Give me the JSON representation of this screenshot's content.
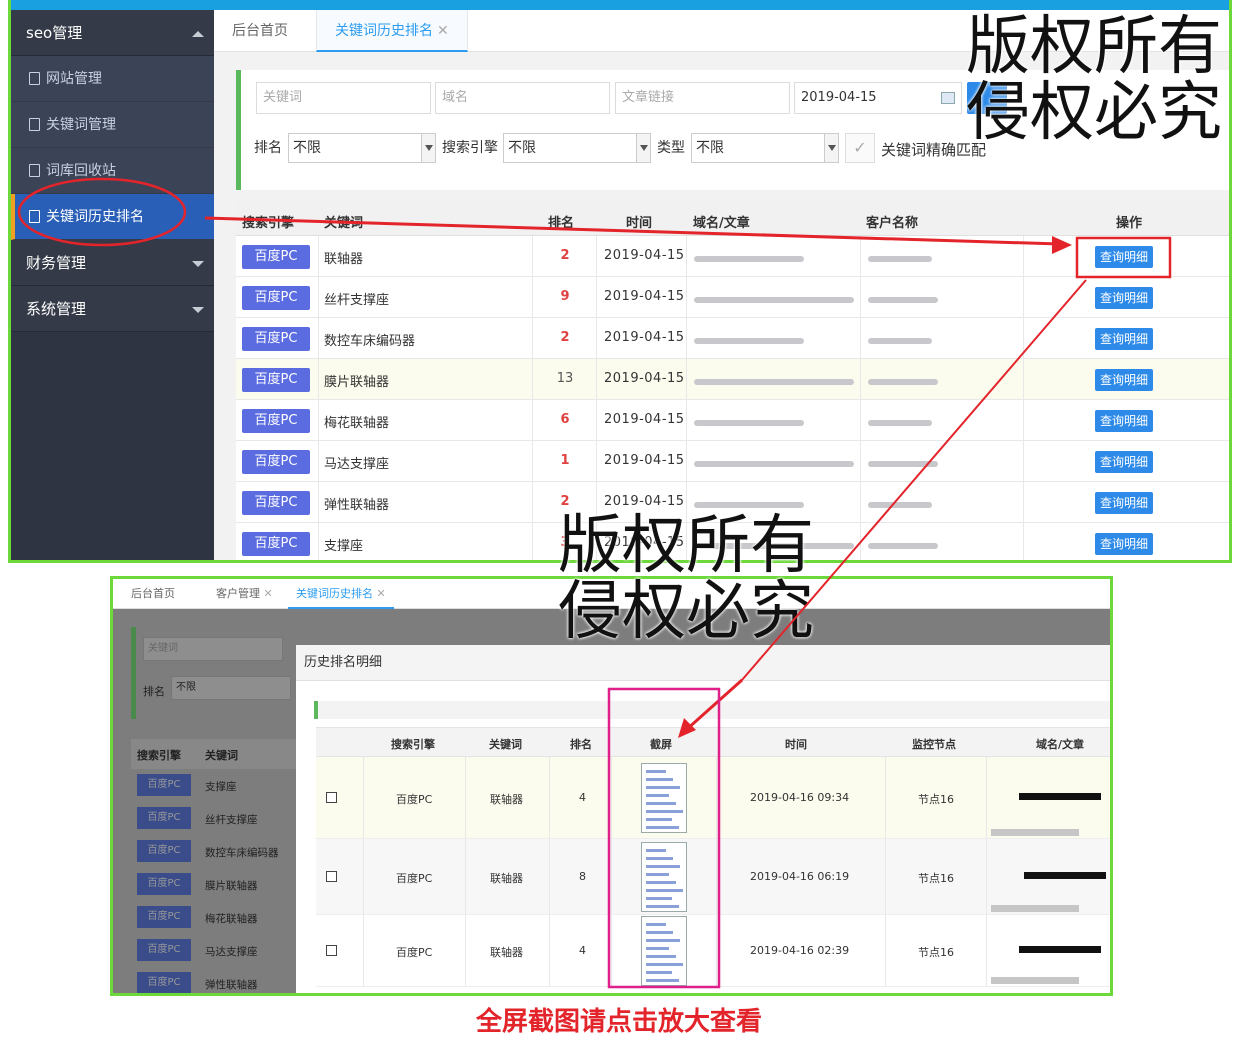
{
  "sidebar": {
    "group_seo": "seo管理",
    "items": [
      "网站管理",
      "关键词管理",
      "词库回收站",
      "关键词历史排名"
    ],
    "group_finance": "财务管理",
    "group_system": "系统管理"
  },
  "tabs": {
    "home": "后台首页",
    "active": "关键词历史排名",
    "close": "✕"
  },
  "filter": {
    "keyword_placeholder": "关键词",
    "domain_placeholder": "域名",
    "article_placeholder": "文章链接",
    "date_value": "2019-04-15",
    "rank_label": "排名",
    "rank_value": "不限",
    "engine_label": "搜索引擎",
    "engine_value": "不限",
    "type_label": "类型",
    "type_value": "不限",
    "exact_label": "关键词精确匹配",
    "check_mark": "✓"
  },
  "table": {
    "headers": [
      "搜索引擎",
      "关键词",
      "排名",
      "时间",
      "域名/文章",
      "客户名称",
      "操作"
    ],
    "button_label": "查询明细",
    "rows": [
      {
        "engine": "百度PC",
        "keyword": "联轴器",
        "rank": "2",
        "date": "2019-04-15"
      },
      {
        "engine": "百度PC",
        "keyword": "丝杆支撑座",
        "rank": "9",
        "date": "2019-04-15"
      },
      {
        "engine": "百度PC",
        "keyword": "数控车床编码器",
        "rank": "2",
        "date": "2019-04-15"
      },
      {
        "engine": "百度PC",
        "keyword": "膜片联轴器",
        "rank": "13",
        "date": "2019-04-15"
      },
      {
        "engine": "百度PC",
        "keyword": "梅花联轴器",
        "rank": "6",
        "date": "2019-04-15"
      },
      {
        "engine": "百度PC",
        "keyword": "马达支撑座",
        "rank": "1",
        "date": "2019-04-15"
      },
      {
        "engine": "百度PC",
        "keyword": "弹性联轴器",
        "rank": "2",
        "date": "2019-04-15"
      },
      {
        "engine": "百度PC",
        "keyword": "支撑座",
        "rank": "3",
        "date": "2019-04-15"
      }
    ]
  },
  "bottom": {
    "tabs": [
      "后台首页",
      "客户管理",
      "关键词历史排名"
    ],
    "shade_keyword_placeholder": "关键词",
    "shade_rank_label": "排名",
    "shade_rank_value": "不限",
    "shade_headers": [
      "搜索引擎",
      "关键词"
    ],
    "shade_rows": [
      {
        "engine": "百度PC",
        "keyword": "支撑座"
      },
      {
        "engine": "百度PC",
        "keyword": "丝杆支撑座"
      },
      {
        "engine": "百度PC",
        "keyword": "数控车床编码器"
      },
      {
        "engine": "百度PC",
        "keyword": "膜片联轴器"
      },
      {
        "engine": "百度PC",
        "keyword": "梅花联轴器"
      },
      {
        "engine": "百度PC",
        "keyword": "马达支撑座"
      },
      {
        "engine": "百度PC",
        "keyword": "弹性联轴器"
      }
    ],
    "modal_title": "历史排名明细",
    "modal_headers": [
      "搜索引擎",
      "关键词",
      "排名",
      "截屏",
      "时间",
      "监控节点",
      "域名/文章"
    ],
    "modal_rows": [
      {
        "engine": "百度PC",
        "keyword": "联轴器",
        "rank": "4",
        "time": "2019-04-16 09:34",
        "node": "节点16"
      },
      {
        "engine": "百度PC",
        "keyword": "联轴器",
        "rank": "8",
        "time": "2019-04-16 06:19",
        "node": "节点16"
      },
      {
        "engine": "百度PC",
        "keyword": "联轴器",
        "rank": "4",
        "time": "2019-04-16 02:39",
        "node": "节点16"
      }
    ]
  },
  "watermark": {
    "line1": "版权所有",
    "line2": "侵权必究"
  },
  "caption": "全屏截图请点击放大查看",
  "colors": {
    "accent": "#2d8ae8",
    "annotation": "#e3242b",
    "frame": "#6cd83a"
  }
}
